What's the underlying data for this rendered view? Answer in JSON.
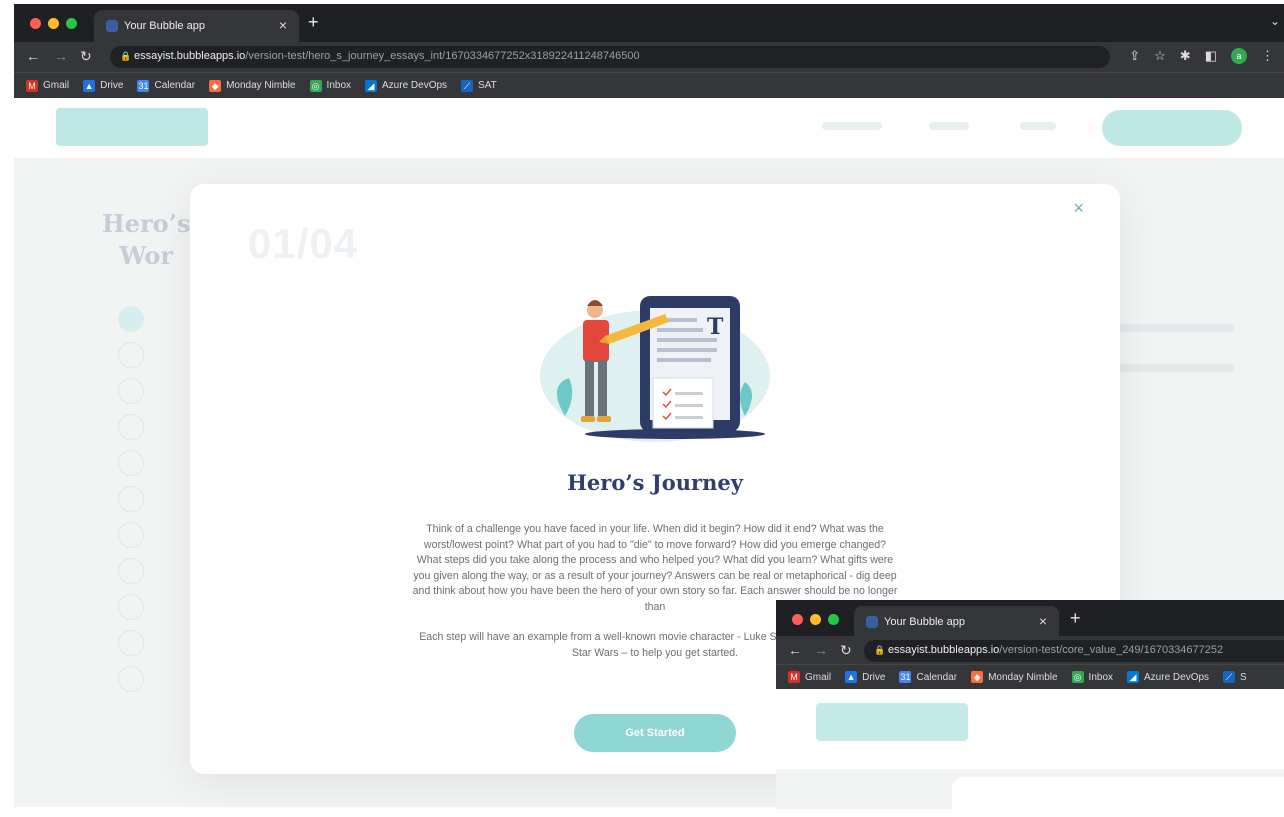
{
  "browser": {
    "tab_title": "Your Bubble app",
    "tab_close": "×",
    "new_tab": "+",
    "url_host": "essayist.bubbleapps.io",
    "url_path": "/version-test/hero_s_journey_essays_int/1670334677252x318922411248746500",
    "avatar_letter": "a",
    "bookmarks": [
      {
        "label": "Gmail",
        "icon_color": "#d93025",
        "icon": "M"
      },
      {
        "label": "Drive",
        "icon_color": "#1a73e8",
        "icon": "▲"
      },
      {
        "label": "Calendar",
        "icon_color": "#4285f4",
        "icon": "31"
      },
      {
        "label": "Monday Nimble",
        "icon_color": "#ff6b3d",
        "icon": "◆"
      },
      {
        "label": "Inbox",
        "icon_color": "#34a853",
        "icon": "◎"
      },
      {
        "label": "Azure DevOps",
        "icon_color": "#0078d4",
        "icon": "◢"
      },
      {
        "label": "SAT",
        "icon_color": "#1565c0",
        "icon": "⟋"
      }
    ]
  },
  "modal": {
    "close": "×",
    "step_counter": "01/04",
    "title": "Hero’s Journey",
    "body_p1": "Think of a challenge you have faced in your life. When did it begin? How did it end? What was the worst/lowest point? What part of you had to \"die\" to move forward? How did you emerge changed? What steps did you take along the process and who helped you? What did you learn? What gifts were you given along the way, or as a result of your journey? Answers can be real or metaphorical - dig deep and think about how you have been the hero of your own story so far. Each answer should be no longer than",
    "body_p2": "Each step will have an example from a well-known movie character - Luke Skywalker from the movie Star Wars – to help you get started.",
    "cta": "Get Started"
  },
  "background": {
    "title_line1": "Hero’s",
    "title_line2": "Wor"
  },
  "browser2": {
    "tab_title": "Your Bubble app",
    "tab_close": "×",
    "new_tab": "+",
    "url_host": "essayist.bubbleapps.io",
    "url_path": "/version-test/core_value_249/1670334677252",
    "bookmarks": [
      {
        "label": "Gmail",
        "icon_color": "#d93025",
        "icon": "M"
      },
      {
        "label": "Drive",
        "icon_color": "#1a73e8",
        "icon": "▲"
      },
      {
        "label": "Calendar",
        "icon_color": "#4285f4",
        "icon": "31"
      },
      {
        "label": "Monday Nimble",
        "icon_color": "#ff6b3d",
        "icon": "◆"
      },
      {
        "label": "Inbox",
        "icon_color": "#34a853",
        "icon": "◎"
      },
      {
        "label": "Azure DevOps",
        "icon_color": "#0078d4",
        "icon": "◢"
      },
      {
        "label": "S",
        "icon_color": "#1565c0",
        "icon": "⟋"
      }
    ]
  },
  "colors": {
    "accent": "#8fd6d4",
    "title_navy": "#2f3e6b",
    "chrome_dark": "#1f2023"
  }
}
